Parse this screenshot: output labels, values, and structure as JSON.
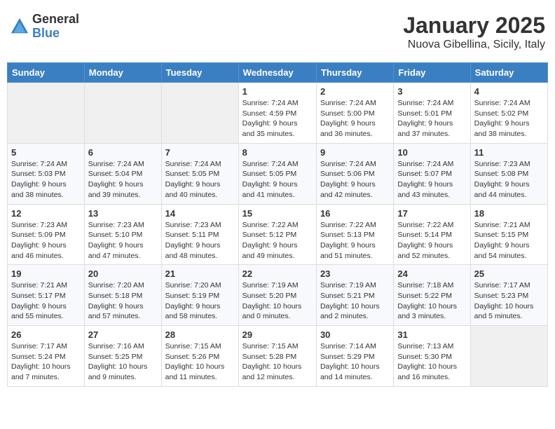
{
  "logo": {
    "general": "General",
    "blue": "Blue"
  },
  "title": "January 2025",
  "location": "Nuova Gibellina, Sicily, Italy",
  "days_of_week": [
    "Sunday",
    "Monday",
    "Tuesday",
    "Wednesday",
    "Thursday",
    "Friday",
    "Saturday"
  ],
  "weeks": [
    [
      {
        "day": "",
        "info": ""
      },
      {
        "day": "",
        "info": ""
      },
      {
        "day": "",
        "info": ""
      },
      {
        "day": "1",
        "info": "Sunrise: 7:24 AM\nSunset: 4:59 PM\nDaylight: 9 hours\nand 35 minutes."
      },
      {
        "day": "2",
        "info": "Sunrise: 7:24 AM\nSunset: 5:00 PM\nDaylight: 9 hours\nand 36 minutes."
      },
      {
        "day": "3",
        "info": "Sunrise: 7:24 AM\nSunset: 5:01 PM\nDaylight: 9 hours\nand 37 minutes."
      },
      {
        "day": "4",
        "info": "Sunrise: 7:24 AM\nSunset: 5:02 PM\nDaylight: 9 hours\nand 38 minutes."
      }
    ],
    [
      {
        "day": "5",
        "info": "Sunrise: 7:24 AM\nSunset: 5:03 PM\nDaylight: 9 hours\nand 38 minutes."
      },
      {
        "day": "6",
        "info": "Sunrise: 7:24 AM\nSunset: 5:04 PM\nDaylight: 9 hours\nand 39 minutes."
      },
      {
        "day": "7",
        "info": "Sunrise: 7:24 AM\nSunset: 5:05 PM\nDaylight: 9 hours\nand 40 minutes."
      },
      {
        "day": "8",
        "info": "Sunrise: 7:24 AM\nSunset: 5:05 PM\nDaylight: 9 hours\nand 41 minutes."
      },
      {
        "day": "9",
        "info": "Sunrise: 7:24 AM\nSunset: 5:06 PM\nDaylight: 9 hours\nand 42 minutes."
      },
      {
        "day": "10",
        "info": "Sunrise: 7:24 AM\nSunset: 5:07 PM\nDaylight: 9 hours\nand 43 minutes."
      },
      {
        "day": "11",
        "info": "Sunrise: 7:23 AM\nSunset: 5:08 PM\nDaylight: 9 hours\nand 44 minutes."
      }
    ],
    [
      {
        "day": "12",
        "info": "Sunrise: 7:23 AM\nSunset: 5:09 PM\nDaylight: 9 hours\nand 46 minutes."
      },
      {
        "day": "13",
        "info": "Sunrise: 7:23 AM\nSunset: 5:10 PM\nDaylight: 9 hours\nand 47 minutes."
      },
      {
        "day": "14",
        "info": "Sunrise: 7:23 AM\nSunset: 5:11 PM\nDaylight: 9 hours\nand 48 minutes."
      },
      {
        "day": "15",
        "info": "Sunrise: 7:22 AM\nSunset: 5:12 PM\nDaylight: 9 hours\nand 49 minutes."
      },
      {
        "day": "16",
        "info": "Sunrise: 7:22 AM\nSunset: 5:13 PM\nDaylight: 9 hours\nand 51 minutes."
      },
      {
        "day": "17",
        "info": "Sunrise: 7:22 AM\nSunset: 5:14 PM\nDaylight: 9 hours\nand 52 minutes."
      },
      {
        "day": "18",
        "info": "Sunrise: 7:21 AM\nSunset: 5:15 PM\nDaylight: 9 hours\nand 54 minutes."
      }
    ],
    [
      {
        "day": "19",
        "info": "Sunrise: 7:21 AM\nSunset: 5:17 PM\nDaylight: 9 hours\nand 55 minutes."
      },
      {
        "day": "20",
        "info": "Sunrise: 7:20 AM\nSunset: 5:18 PM\nDaylight: 9 hours\nand 57 minutes."
      },
      {
        "day": "21",
        "info": "Sunrise: 7:20 AM\nSunset: 5:19 PM\nDaylight: 9 hours\nand 58 minutes."
      },
      {
        "day": "22",
        "info": "Sunrise: 7:19 AM\nSunset: 5:20 PM\nDaylight: 10 hours\nand 0 minutes."
      },
      {
        "day": "23",
        "info": "Sunrise: 7:19 AM\nSunset: 5:21 PM\nDaylight: 10 hours\nand 2 minutes."
      },
      {
        "day": "24",
        "info": "Sunrise: 7:18 AM\nSunset: 5:22 PM\nDaylight: 10 hours\nand 3 minutes."
      },
      {
        "day": "25",
        "info": "Sunrise: 7:17 AM\nSunset: 5:23 PM\nDaylight: 10 hours\nand 5 minutes."
      }
    ],
    [
      {
        "day": "26",
        "info": "Sunrise: 7:17 AM\nSunset: 5:24 PM\nDaylight: 10 hours\nand 7 minutes."
      },
      {
        "day": "27",
        "info": "Sunrise: 7:16 AM\nSunset: 5:25 PM\nDaylight: 10 hours\nand 9 minutes."
      },
      {
        "day": "28",
        "info": "Sunrise: 7:15 AM\nSunset: 5:26 PM\nDaylight: 10 hours\nand 11 minutes."
      },
      {
        "day": "29",
        "info": "Sunrise: 7:15 AM\nSunset: 5:28 PM\nDaylight: 10 hours\nand 12 minutes."
      },
      {
        "day": "30",
        "info": "Sunrise: 7:14 AM\nSunset: 5:29 PM\nDaylight: 10 hours\nand 14 minutes."
      },
      {
        "day": "31",
        "info": "Sunrise: 7:13 AM\nSunset: 5:30 PM\nDaylight: 10 hours\nand 16 minutes."
      },
      {
        "day": "",
        "info": ""
      }
    ]
  ]
}
